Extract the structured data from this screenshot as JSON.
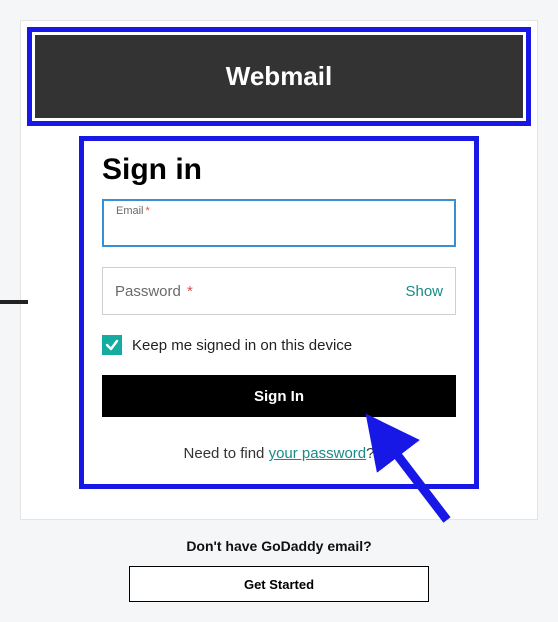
{
  "header": {
    "title": "Webmail"
  },
  "form": {
    "title": "Sign in",
    "email_label": "Email",
    "password_label": "Password",
    "show_text": "Show",
    "remember_label": "Keep me signed in on this device",
    "submit_label": "Sign In",
    "help_prefix": "Need to find ",
    "help_link": "your password",
    "help_suffix": "?"
  },
  "cta": {
    "prompt": "Don't have GoDaddy email?",
    "button": "Get Started"
  }
}
